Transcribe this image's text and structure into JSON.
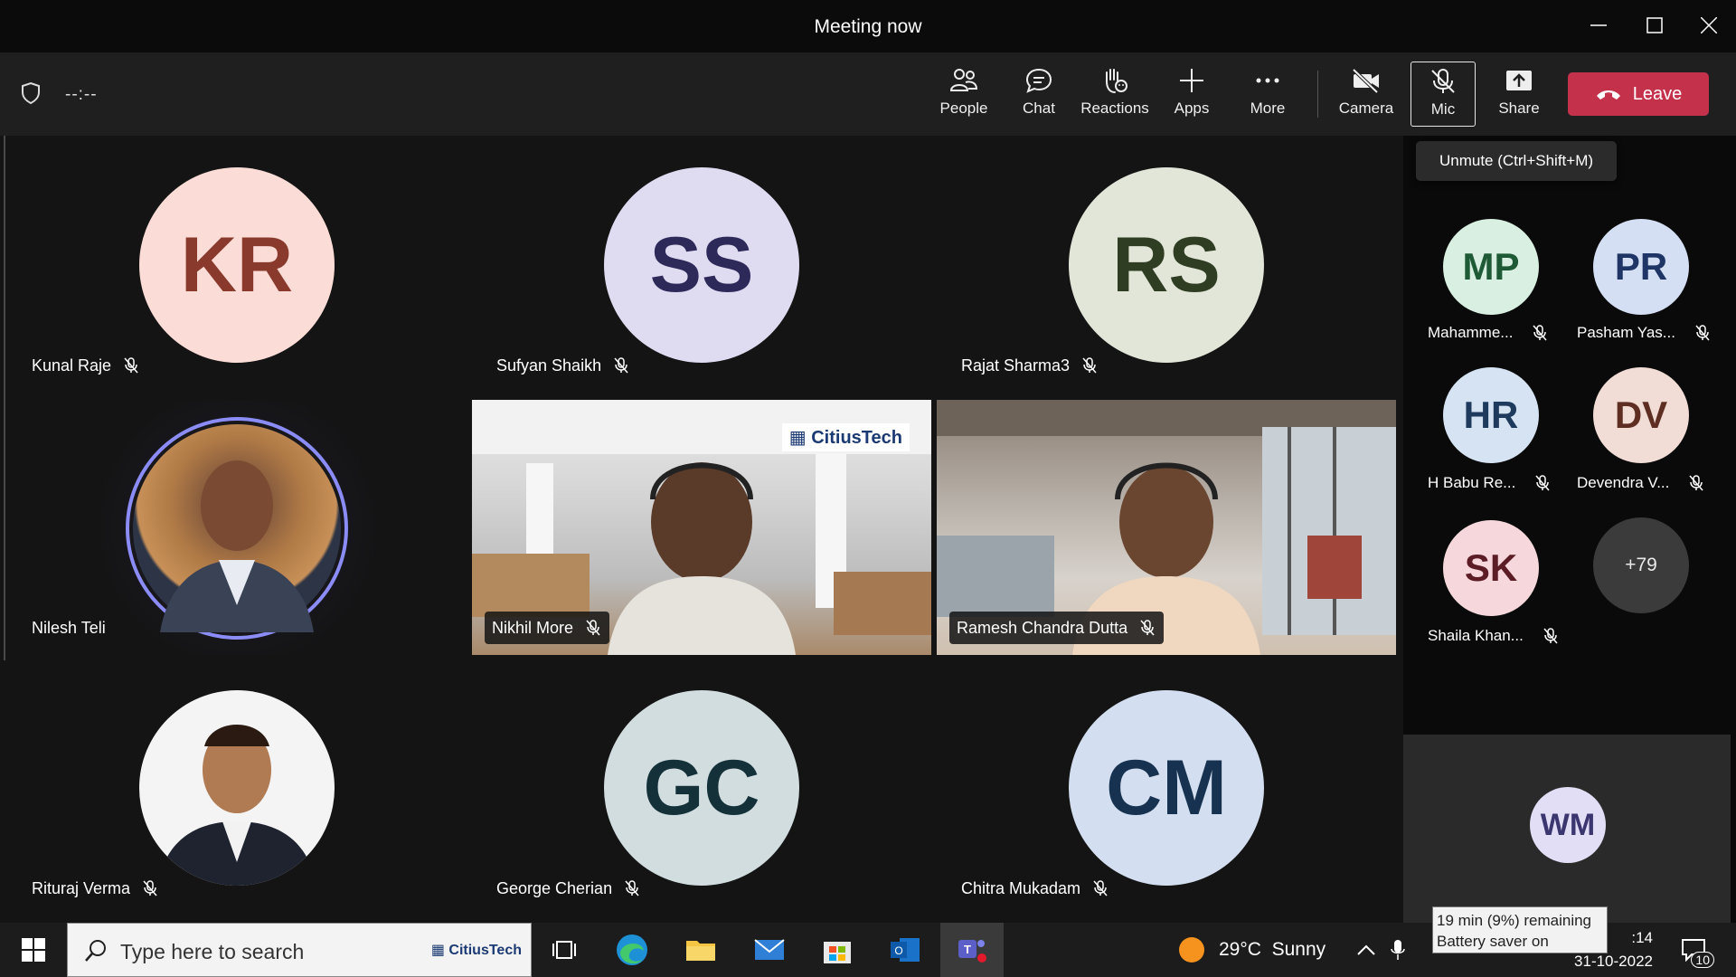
{
  "window": {
    "title": "Meeting now"
  },
  "toolbar": {
    "timer": "--:--",
    "buttons": {
      "people": "People",
      "chat": "Chat",
      "reactions": "Reactions",
      "apps": "Apps",
      "more": "More",
      "camera": "Camera",
      "mic": "Mic",
      "share": "Share"
    },
    "leave_label": "Leave",
    "tooltip": "Unmute (Ctrl+Shift+M)"
  },
  "tiles": [
    {
      "name": "Kunal Raje",
      "initials": "KR",
      "bg": "#fbdcd7",
      "fg": "#8a3a2c"
    },
    {
      "name": "Sufyan Shaikh",
      "initials": "SS",
      "bg": "#dfdcf2",
      "fg": "#2d2a5a"
    },
    {
      "name": "Rajat Sharma3",
      "initials": "RS",
      "bg": "#e2e6d8",
      "fg": "#2f3d22"
    },
    {
      "name": "Nilesh Teli",
      "initials": "",
      "bg": "",
      "fg": ""
    },
    {
      "name": "Nikhil More",
      "initials": "",
      "bg": "",
      "fg": ""
    },
    {
      "name": "Ramesh Chandra Dutta",
      "initials": "",
      "bg": "",
      "fg": ""
    },
    {
      "name": "Rituraj Verma",
      "initials": "",
      "bg": "",
      "fg": ""
    },
    {
      "name": "George Cherian",
      "initials": "GC",
      "bg": "#d2dde0",
      "fg": "#14313a"
    },
    {
      "name": "Chitra Mukadam",
      "initials": "CM",
      "bg": "#d3dff0",
      "fg": "#163250"
    }
  ],
  "video_brand": "CitiusTech",
  "sidebar": [
    {
      "name": "Mahamme...",
      "initials": "MP",
      "bg": "#d8efe1",
      "fg": "#1f5a36"
    },
    {
      "name": "Pasham Yas...",
      "initials": "PR",
      "bg": "#d5dff3",
      "fg": "#1e3566"
    },
    {
      "name": "H Babu Re...",
      "initials": "HR",
      "bg": "#d6e3f3",
      "fg": "#1e3a5c"
    },
    {
      "name": "Devendra V...",
      "initials": "DV",
      "bg": "#f1dcd6",
      "fg": "#5e2e22"
    },
    {
      "name": "Shaila Khan...",
      "initials": "SK",
      "bg": "#f6d8dc",
      "fg": "#5c1c26"
    }
  ],
  "overflow_count": "+79",
  "self_view": {
    "initials": "WM",
    "bg": "#e2def6",
    "fg": "#3b3570"
  },
  "taskbar": {
    "search_placeholder": "Type here to search",
    "search_brand": "CitiusTech",
    "weather": "29°C  Sunny",
    "time": ":14",
    "date": "31-10-2022",
    "notifications": "10",
    "battery_line1": "19 min (9%) remaining",
    "battery_line2": "Battery saver on"
  },
  "colors": {
    "leave": "#c4314b",
    "active_ring": "#8b8cf6"
  }
}
